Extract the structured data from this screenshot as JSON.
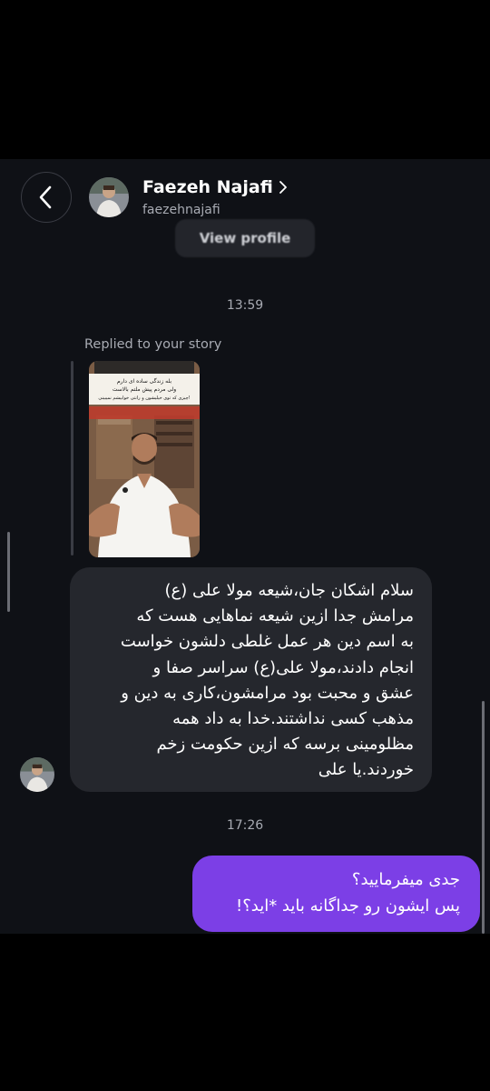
{
  "header": {
    "contact_name": "Faezeh Najafi",
    "username": "faezehnajafi",
    "view_profile_label": "View profile"
  },
  "icons": {
    "back": "chevron-left-icon",
    "profile_link": "chevron-right-icon"
  },
  "thread": {
    "timestamp_1": "13:59",
    "replied_label": "Replied to your story",
    "story": {
      "caption_line_1": "بله زندگی ساده ای دارم",
      "caption_line_2": "ولی مردم پیش ملتم بالاست",
      "caption_line_3": "چیزی که توی خیلیشون و رانتی خوابیشم نمیبینی!"
    },
    "incoming_message": {
      "lines": [
        "سلام اشکان جان،شیعه مولا علی (ع)",
        "مرامش جدا ازین شیعه نماهایی هست که",
        "به اسم دین هر عمل غلطی دلشون خواست",
        "انجام دادند،مولا علی(ع) سراسر صفا و",
        "عشق و محبت بود مرامشون،کاری به دین و",
        "مذهب کسی نداشتند.خدا به داد همه",
        "مظلومینی برسه که ازین حکومت زخم",
        "خوردند.یا علی"
      ]
    },
    "timestamp_2": "17:26",
    "outgoing_message": {
      "lines": [
        "جدی میفرمایید؟",
        "پس ایشون رو جداگانه باید *اید؟!"
      ]
    }
  },
  "colors": {
    "background": "#0f1116",
    "incoming_bubble": "#25272d",
    "outgoing_bubble": "#7c3fe6",
    "secondary_text": "#a8abb3"
  }
}
